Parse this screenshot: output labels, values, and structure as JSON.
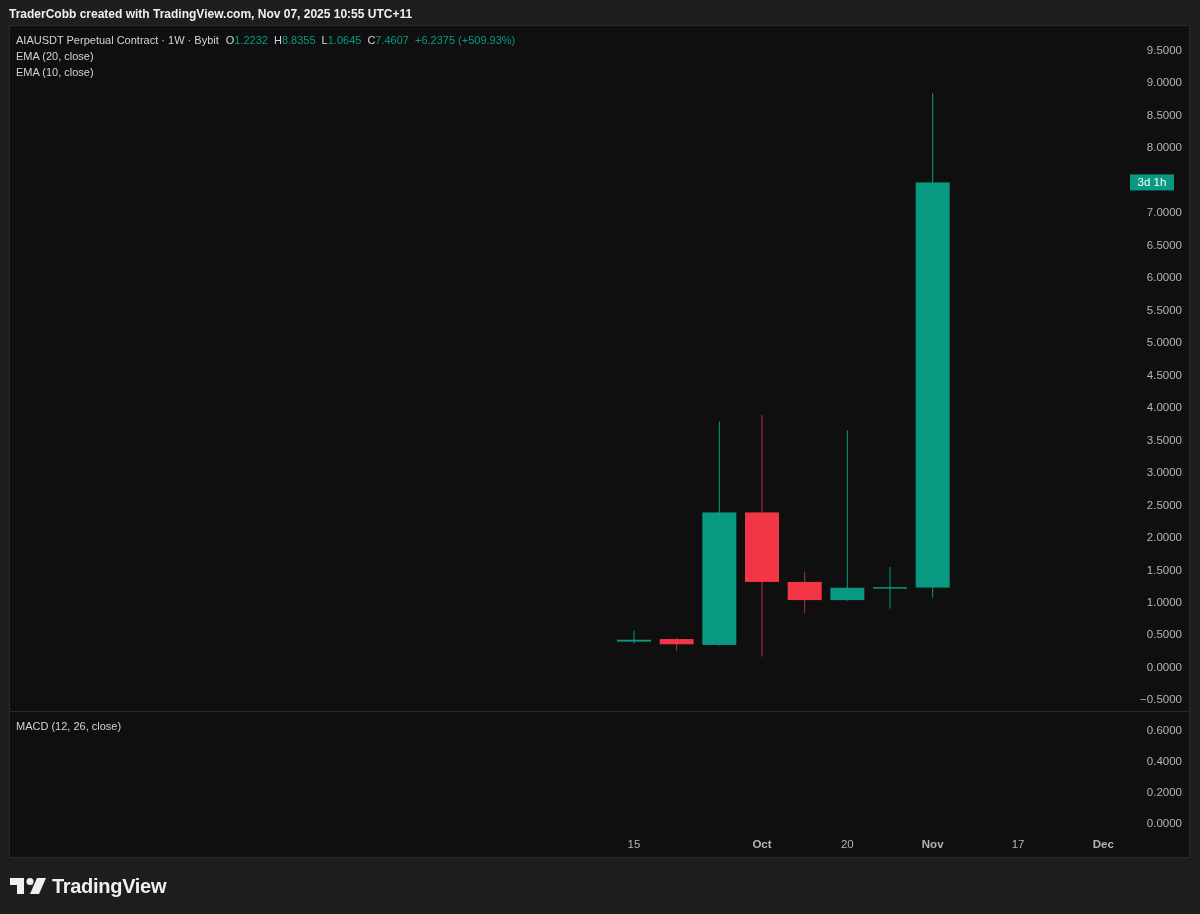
{
  "header": {
    "caption": "TraderCobb created with TradingView.com, Nov 07, 2025 10:55 UTC+11"
  },
  "price_pane": {
    "symbol": "AIAUSDT Perpetual Contract · 1W · Bybit",
    "ohlc": [
      {
        "label": "O",
        "value": "1.2232"
      },
      {
        "label": "H",
        "value": "8.8355"
      },
      {
        "label": "L",
        "value": "1.0645"
      },
      {
        "label": "C",
        "value": "7.4607"
      }
    ],
    "change": "+6.2375 (+509.93%)",
    "indicators": [
      "EMA (20, close)",
      "EMA (10, close)"
    ],
    "countdown": "3d 1h",
    "scale": [
      "9.5000",
      "9.0000",
      "8.5000",
      "8.0000",
      "7.0000",
      "6.5000",
      "6.0000",
      "5.5000",
      "5.0000",
      "4.5000",
      "4.0000",
      "3.5000",
      "3.0000",
      "2.5000",
      "2.0000",
      "1.5000",
      "1.0000",
      "0.5000",
      "0.0000",
      "−0.5000"
    ]
  },
  "macd_pane": {
    "label": "MACD (12, 26, close)",
    "scale": [
      "0.6000",
      "0.4000",
      "0.2000",
      "0.0000"
    ]
  },
  "time_axis": [
    {
      "label": "15",
      "bold": false
    },
    {
      "label": "Oct",
      "bold": true
    },
    {
      "label": "20",
      "bold": false
    },
    {
      "label": "Nov",
      "bold": true
    },
    {
      "label": "17",
      "bold": false
    },
    {
      "label": "Dec",
      "bold": true
    }
  ],
  "footer": {
    "brand": "TradingView"
  }
}
